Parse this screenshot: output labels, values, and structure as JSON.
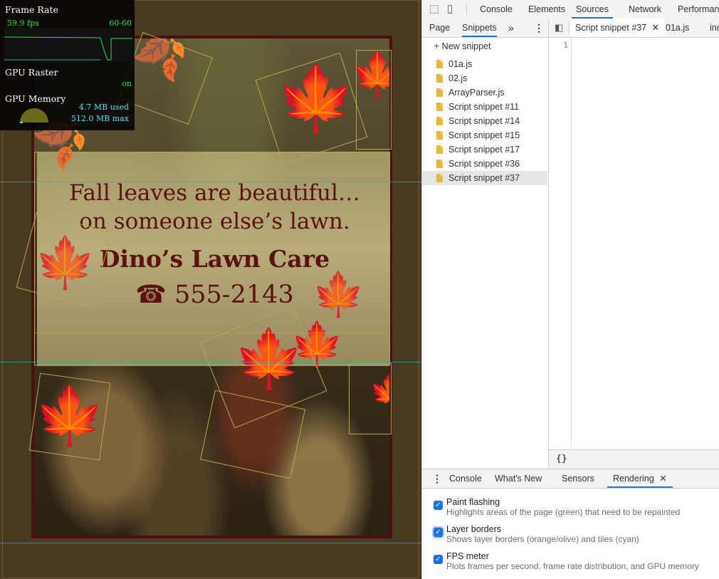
{
  "poster": {
    "line1": "Fall leaves are beautiful…",
    "line2": "on someone else’s lawn.",
    "business": "Dino’s Lawn Care",
    "phone": "☎ 555-2143"
  },
  "fps_meter": {
    "frame_rate_label": "Frame Rate",
    "fps": "59.9 fps",
    "range": "60-60",
    "gpu_raster_label": "GPU Raster",
    "gpu_raster_status": "on",
    "gpu_memory_label": "GPU Memory",
    "memory_used": "4.7 MB used",
    "memory_max": "512.0 MB max"
  },
  "devtools": {
    "main_tabs": [
      "Console",
      "Elements",
      "Sources",
      "Network",
      "Performance"
    ],
    "active_main_tab": "Sources",
    "nav_tabs": [
      "Page",
      "Snippets"
    ],
    "more_tabs_glyph": "»",
    "new_snippet": "New snippet",
    "files": [
      "01a.js",
      "02.js",
      "ArrayParser.js",
      "Script snippet #11",
      "Script snippet #14",
      "Script snippet #15",
      "Script snippet #17",
      "Script snippet #36",
      "Script snippet #37"
    ],
    "selected_file": "Script snippet #37",
    "editor_tabs": [
      "Script snippet #37",
      "01a.js",
      "index"
    ],
    "line_number": "1",
    "pretty_print": "{}",
    "drawer_tabs": [
      "Console",
      "What's New",
      "Sensors",
      "Rendering"
    ],
    "active_drawer_tab": "Rendering",
    "rendering_options": [
      {
        "title": "Paint flashing",
        "desc": "Highlights areas of the page (green) that need to be repainted",
        "checked": true
      },
      {
        "title": "Layer borders",
        "desc": "Shows layer borders (orange/olive) and tiles (cyan)",
        "checked": true
      },
      {
        "title": "FPS meter",
        "desc": "Plots frames per second, frame rate distribution, and GPU memory",
        "checked": true
      }
    ]
  },
  "colors": {
    "accent": "#1a73e8",
    "poster_text": "#5a1212",
    "fps_green": "#2ee62e",
    "fps_cyan": "#4fe3ff",
    "tile_border": "#3fa7b5",
    "layer_border": "#b5a752"
  }
}
